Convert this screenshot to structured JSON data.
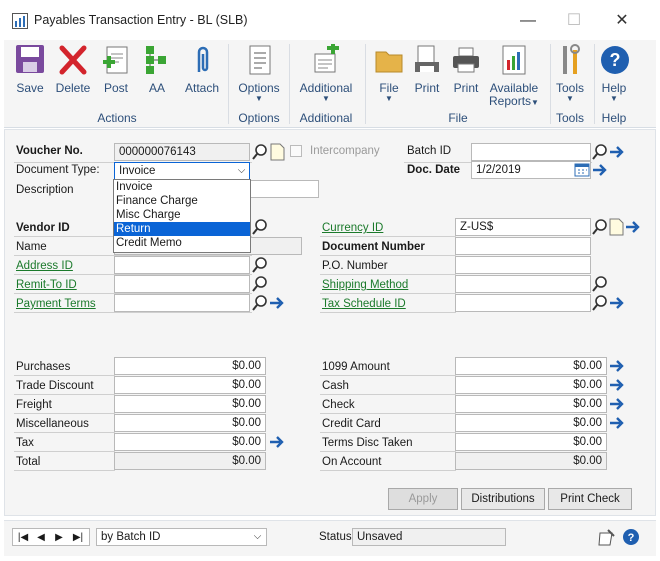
{
  "window": {
    "title": "Payables Transaction Entry  -  BL (SLB)",
    "minimize": "—",
    "maximize": "☐",
    "close": "✕"
  },
  "ribbon": {
    "save": "Save",
    "delete": "Delete",
    "post": "Post",
    "aa": "AA",
    "attach": "Attach",
    "actions_group": "Actions",
    "options": "Options",
    "options_group": "Options",
    "additional": "Additional",
    "additional_group": "Additional",
    "file": "File",
    "print1": "Print",
    "print2": "Print",
    "available": "Available",
    "reports": "Reports",
    "file_group": "File",
    "tools": "Tools",
    "tools_group": "Tools",
    "help": "Help",
    "help_group": "Help"
  },
  "header": {
    "voucher_label": "Voucher No.",
    "voucher_value": "000000076143",
    "intercompany_label": "Intercompany",
    "batch_label": "Batch ID",
    "batch_value": "",
    "doc_type_label": "Document Type:",
    "doc_type_value": "Invoice",
    "doc_date_label": "Doc. Date",
    "doc_date_value": "1/2/2019",
    "description_label": "Description"
  },
  "dropdown": {
    "options": [
      "Invoice",
      "Finance Charge",
      "Misc Charge",
      "Return",
      "Credit Memo"
    ],
    "selected": "Return"
  },
  "vendor": {
    "vendor_id_label": "Vendor ID",
    "name_label": "Name",
    "address_id_label": "Address ID",
    "remit_to_label": "Remit-To ID",
    "payment_terms_label": "Payment Terms",
    "currency_id_label": "Currency ID",
    "currency_id_value": "Z-US$",
    "doc_number_label": "Document Number",
    "po_number_label": "P.O. Number",
    "shipping_method_label": "Shipping Method",
    "tax_schedule_label": "Tax Schedule ID"
  },
  "amounts_left": [
    {
      "label": "Purchases",
      "value": "$0.00"
    },
    {
      "label": "Trade Discount",
      "value": "$0.00"
    },
    {
      "label": "Freight",
      "value": "$0.00"
    },
    {
      "label": "Miscellaneous",
      "value": "$0.00"
    },
    {
      "label": "Tax",
      "value": "$0.00"
    },
    {
      "label": "Total",
      "value": "$0.00"
    }
  ],
  "amounts_right": [
    {
      "label": "1099 Amount",
      "value": "$0.00"
    },
    {
      "label": "Cash",
      "value": "$0.00"
    },
    {
      "label": "Check",
      "value": "$0.00"
    },
    {
      "label": "Credit Card",
      "value": "$0.00"
    },
    {
      "label": "Terms Disc Taken",
      "value": "$0.00"
    },
    {
      "label": "On Account",
      "value": "$0.00"
    }
  ],
  "buttons": {
    "apply": "Apply",
    "distributions": "Distributions",
    "print_check": "Print Check"
  },
  "statusbar": {
    "sort_value": "by Batch ID",
    "status_label": "Status",
    "status_value": "Unsaved"
  },
  "colors": {
    "accent": "#0a64d6",
    "link": "#1b7a2b",
    "ribbon_text": "#2d4f7a"
  }
}
